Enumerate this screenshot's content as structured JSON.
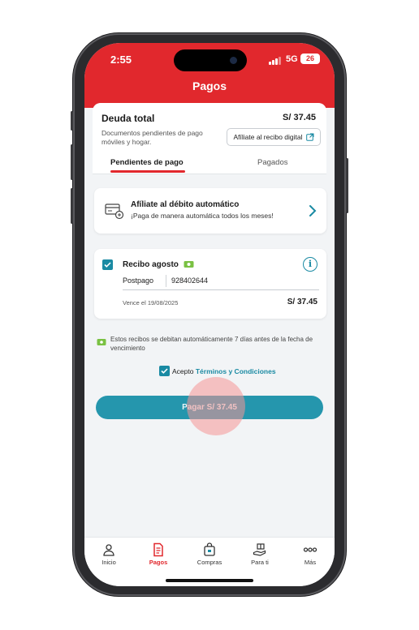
{
  "status": {
    "time": "2:55",
    "network": "5G",
    "battery": "26"
  },
  "header": {
    "title": "Pagos"
  },
  "debt": {
    "title": "Deuda total",
    "amount": "S/ 37.45",
    "description": "Documentos pendientes de pago móviles y hogar.",
    "digital_button": "Afíliate al recibo digital"
  },
  "tabs": [
    {
      "label": "Pendientes de pago",
      "active": true
    },
    {
      "label": "Pagados",
      "active": false
    }
  ],
  "auto_debit": {
    "title": "Afíliate al débito automático",
    "subtitle": "¡Paga de manera automática todos los meses!"
  },
  "receipt": {
    "title": "Recibo agosto",
    "checked": true,
    "plan": "Postpago",
    "number": "928402644",
    "due": "Vence el 19/08/2025",
    "amount": "S/ 37.45"
  },
  "note": "Estos recibos se debitan automáticamente 7 días antes de la fecha de vencimiento",
  "terms": {
    "prefix": "Acepto",
    "link": "Términos y Condiciones",
    "checked": true
  },
  "pay_button": "Pagar S/ 37.45",
  "bottom_nav": [
    {
      "label": "Inicio",
      "icon": "home-user-icon",
      "active": false
    },
    {
      "label": "Pagos",
      "icon": "receipt-icon",
      "active": true
    },
    {
      "label": "Compras",
      "icon": "shopping-bag-icon",
      "active": false
    },
    {
      "label": "Para ti",
      "icon": "gift-hand-icon",
      "active": false
    },
    {
      "label": "Más",
      "icon": "more-icon",
      "active": false
    }
  ],
  "colors": {
    "brand_red": "#e1282d",
    "accent_teal": "#1a8aa3",
    "button_teal": "#2596ad"
  }
}
